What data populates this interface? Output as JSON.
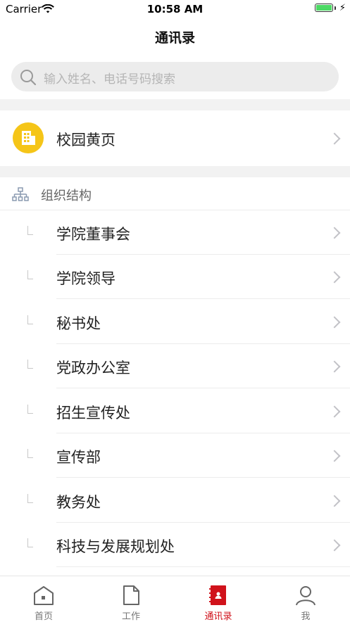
{
  "status_bar": {
    "carrier": "Carrier",
    "time": "10:58 AM",
    "battery_level": 1.0
  },
  "nav": {
    "title": "通讯录"
  },
  "search": {
    "placeholder": "输入姓名、电话号码搜索"
  },
  "yellow_pages": {
    "label": "校园黄页"
  },
  "org": {
    "header": "组织结构",
    "items": [
      {
        "label": "学院董事会"
      },
      {
        "label": "学院领导"
      },
      {
        "label": "秘书处"
      },
      {
        "label": "党政办公室"
      },
      {
        "label": "招生宣传处"
      },
      {
        "label": "宣传部"
      },
      {
        "label": "教务处"
      },
      {
        "label": "科技与发展规划处"
      }
    ]
  },
  "tabbar": {
    "tabs": [
      {
        "label": "首页",
        "icon": "home-icon",
        "active": false
      },
      {
        "label": "工作",
        "icon": "document-icon",
        "active": false
      },
      {
        "label": "通讯录",
        "icon": "contacts-book-icon",
        "active": true
      },
      {
        "label": "我",
        "icon": "person-icon",
        "active": false
      }
    ]
  },
  "colors": {
    "accent": "#d0121b",
    "yellow": "#f5c518",
    "separator": "#f2f2f2"
  }
}
